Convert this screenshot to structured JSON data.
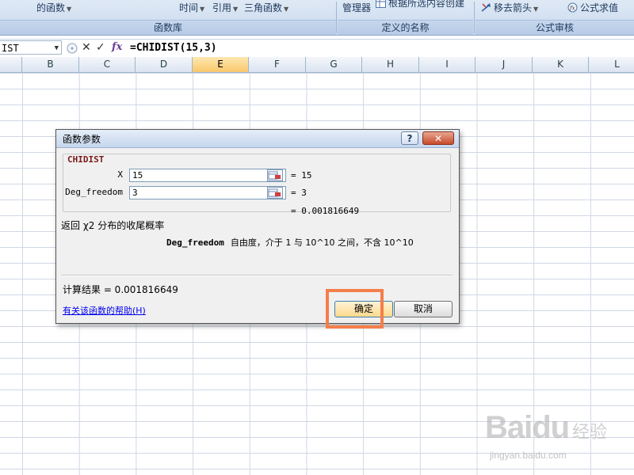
{
  "ribbon": {
    "items": [
      {
        "label": "的函数",
        "dropdown": true
      },
      {
        "label": "时间",
        "dropdown": true
      },
      {
        "label": "引用",
        "dropdown": true
      },
      {
        "label": "三角函数",
        "dropdown": true
      },
      {
        "label": "管理器",
        "dropdown": false
      },
      {
        "label": "根据所选内容创建",
        "dropdown": false
      },
      {
        "label": "移去箭头",
        "dropdown": true
      },
      {
        "label": "公式求值",
        "dropdown": false
      }
    ],
    "groups": [
      "函数库",
      "定义的名称",
      "公式审核"
    ]
  },
  "formula_bar": {
    "name_box": "IST",
    "cancel_glyph": "✕",
    "enter_glyph": "✓",
    "fx_glyph": "fx",
    "formula": "=CHIDIST(15,3)"
  },
  "sheet": {
    "columns": [
      "B",
      "C",
      "D",
      "E",
      "F",
      "G",
      "H",
      "I",
      "J",
      "K",
      "L"
    ],
    "selected_column": "E"
  },
  "dialog": {
    "title": "函数参数",
    "help_glyph": "?",
    "close_glyph": "✕",
    "function_name": "CHIDIST",
    "args": [
      {
        "label": "X",
        "value": "15",
        "result": "= 15"
      },
      {
        "label": "Deg_freedom",
        "value": "3",
        "result": "= 3"
      }
    ],
    "preview": "= 0.001816649",
    "description": "返回 χ2 分布的收尾概率",
    "arg_desc_name": "Deg_freedom",
    "arg_desc_text": "自由度，介于 1 与 10^10 之间，不含 10^10",
    "result_line": "计算结果 =  0.001816649",
    "help_link": "有关该函数的帮助(H)",
    "ok_label": "确定",
    "cancel_label": "取消"
  },
  "watermark": {
    "brand": "Baidu",
    "brand_cn": "经验",
    "url": "jingyan.baidu.com"
  },
  "colors": {
    "highlight_box": "#f47e4a",
    "function_name": "#7a1a1a",
    "link": "#0000ee"
  }
}
